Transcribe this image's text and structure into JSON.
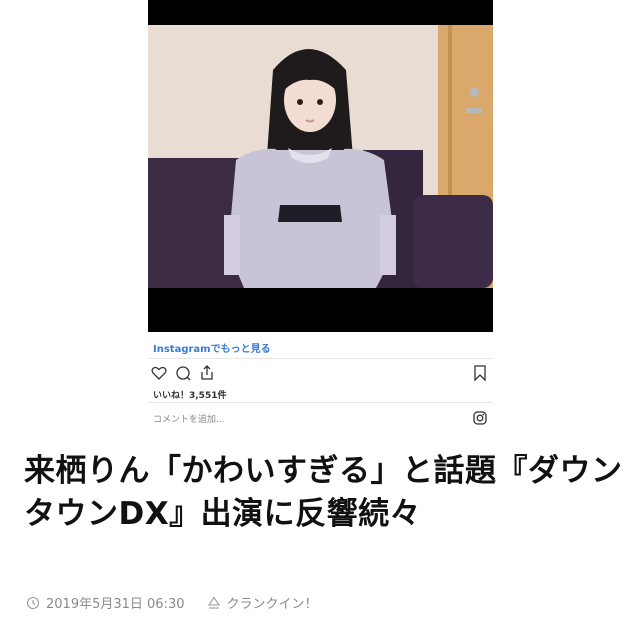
{
  "embed": {
    "more_link": "Instagramでもっと見る",
    "likes": "いいね！3,551件",
    "comment_placeholder": "コメントを追加...",
    "icons": {
      "like": "heart-icon",
      "comment": "comment-icon",
      "share": "share-icon",
      "save": "bookmark-icon",
      "instagram": "instagram-icon"
    }
  },
  "article": {
    "headline": "来栖りん「かわいすぎる」と話題『ダウンタウンDX』出演に反響続々",
    "date": "2019年5月31日 06:30",
    "source": "クランクイン！"
  },
  "colors": {
    "link": "#3a7bd5",
    "meta": "#8a8a8a"
  }
}
